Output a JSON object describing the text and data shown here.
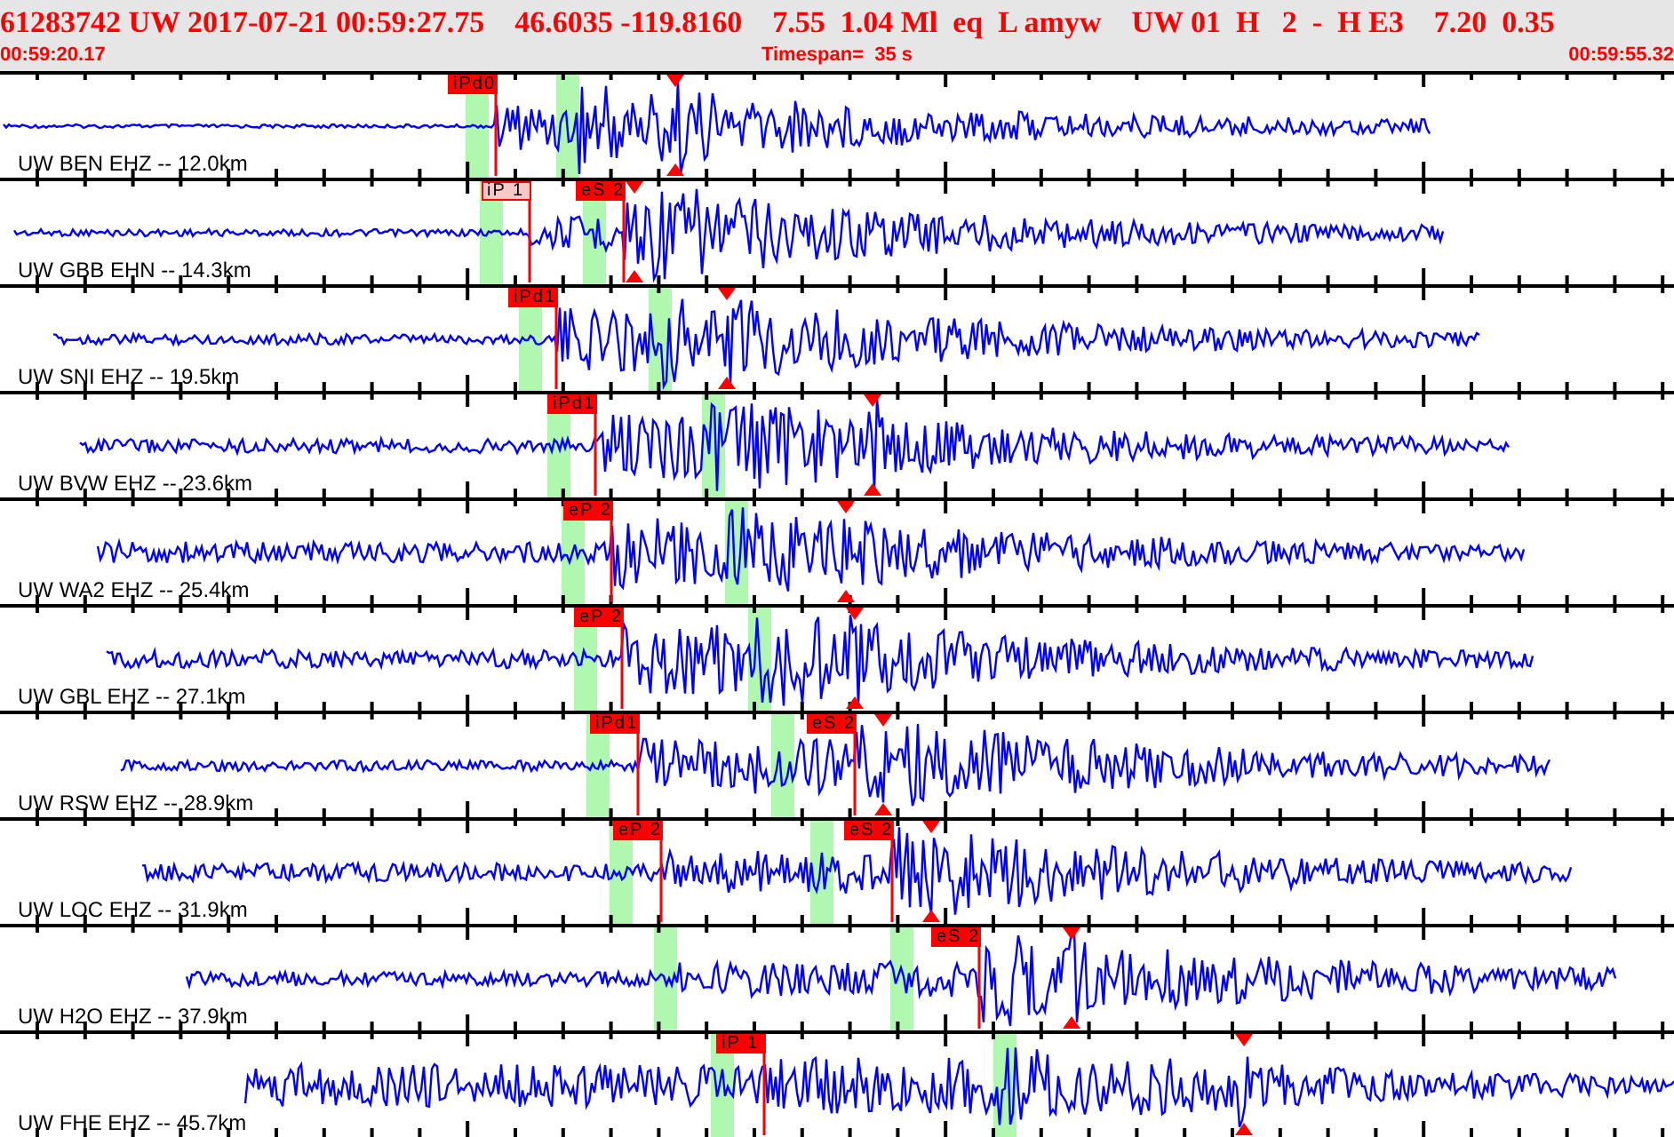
{
  "header": {
    "event_line": [
      "61283742 UW 2017-07-21 00:59:27.75",
      "46.6035 -119.8160",
      "7.55  1.04 Ml  eq  L amyw",
      "UW 01  H   2  -  H E3",
      "7.20  0.35"
    ],
    "start_time": "00:59:20.17",
    "timespan": "Timespan=  35 s",
    "end_time": "00:59:55.32"
  },
  "traces": [
    {
      "label": "UW BEN EHZ -- 12.0km",
      "picks": [
        {
          "label": "iPd0",
          "kind": "solid"
        }
      ]
    },
    {
      "label": "UW GBB EHN -- 14.3km",
      "picks": [
        {
          "label": "iP 1",
          "kind": "faded"
        },
        {
          "label": "eS 2",
          "kind": "solid"
        }
      ]
    },
    {
      "label": "UW SNI EHZ -- 19.5km",
      "picks": [
        {
          "label": "iPd1",
          "kind": "solid"
        }
      ]
    },
    {
      "label": "UW BVW EHZ -- 23.6km",
      "picks": [
        {
          "label": "iPd1",
          "kind": "solid"
        }
      ]
    },
    {
      "label": "UW WA2 EHZ -- 25.4km",
      "picks": [
        {
          "label": "eP 2",
          "kind": "solid"
        }
      ]
    },
    {
      "label": "UW GBL EHZ -- 27.1km",
      "picks": [
        {
          "label": "eP 2",
          "kind": "solid"
        }
      ]
    },
    {
      "label": "UW RSW EHZ -- 28.9km",
      "picks": [
        {
          "label": "iPd1",
          "kind": "solid"
        },
        {
          "label": "eS 2",
          "kind": "solid"
        }
      ]
    },
    {
      "label": "UW LOC EHZ -- 31.9km",
      "picks": [
        {
          "label": "eP 2",
          "kind": "solid"
        },
        {
          "label": "eS 2",
          "kind": "solid"
        }
      ]
    },
    {
      "label": "UW H2O EHZ -- 37.9km",
      "picks": [
        {
          "label": "eS 2",
          "kind": "solid"
        }
      ]
    },
    {
      "label": "UW FHE EHZ -- 45.7km",
      "picks": [
        {
          "label": "iP 1",
          "kind": "solid"
        }
      ]
    }
  ]
}
